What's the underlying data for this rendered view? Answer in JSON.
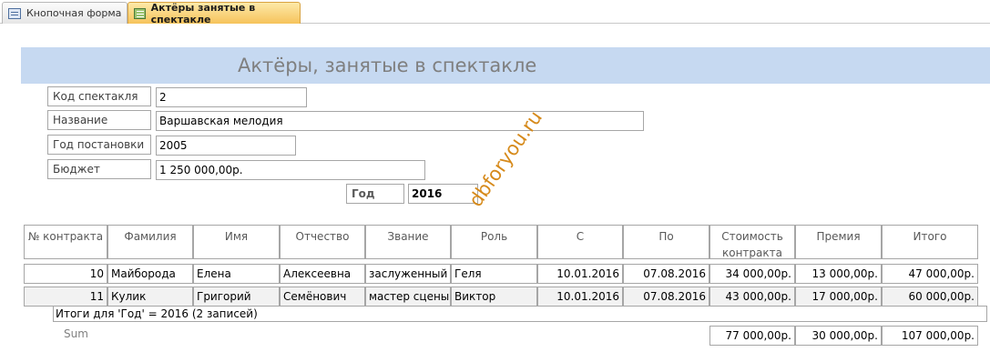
{
  "tabs": [
    {
      "label": "Кнопочная форма",
      "icon": "form-icon",
      "active": false
    },
    {
      "label": "Актёры занятые в спектакле",
      "icon": "report-icon",
      "active": true
    }
  ],
  "report": {
    "title": "Актёры, занятые в спектакле",
    "fields": {
      "code_label": "Код спектакля",
      "code_value": "2",
      "name_label": "Название",
      "name_value": "Варшавская мелодия",
      "year_staged_label": "Год постановки",
      "year_staged_value": "2005",
      "budget_label": "Бюджет",
      "budget_value": "1 250 000,00р."
    },
    "group": {
      "label": "Год",
      "value": "2016"
    },
    "watermark": "dbforyou.ru",
    "columns": [
      "№ контракта",
      "Фамилия",
      "Имя",
      "Отчество",
      "Звание",
      "Роль",
      "С",
      "По",
      "Стоимость контракта",
      "Премия",
      "Итого"
    ],
    "rows": [
      {
        "contract": "10",
        "surname": "Майборода",
        "name": "Елена",
        "patronymic": "Алексеевна",
        "rank": "заслуженный артист",
        "role": "Геля",
        "from": "10.01.2016",
        "to": "07.08.2016",
        "cost": "34 000,00р.",
        "bonus": "13 000,00р.",
        "total": "47 000,00р."
      },
      {
        "contract": "11",
        "surname": "Кулик",
        "name": "Григорий",
        "patronymic": "Семёнович",
        "rank": "мастер сцены",
        "role": "Виктор",
        "from": "10.01.2016",
        "to": "07.08.2016",
        "cost": "43 000,00р.",
        "bonus": "17 000,00р.",
        "total": "60 000,00р."
      }
    ],
    "summary_text": "Итоги для 'Год' =  2016 (2 записей)",
    "sum_label": "Sum",
    "sum_cost": "77 000,00р.",
    "sum_bonus": "30 000,00р.",
    "sum_total": "107 000,00р."
  },
  "colors": {
    "header_band": "#c6d9f1",
    "active_tab": "#f6c35b",
    "watermark": "#d68a1b"
  }
}
